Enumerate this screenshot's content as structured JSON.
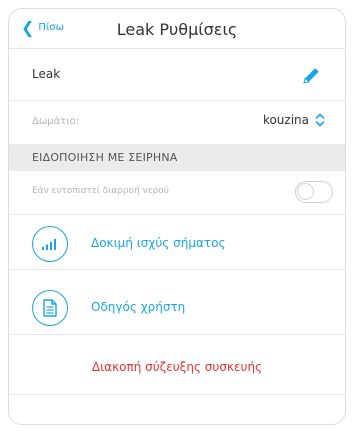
{
  "nav": {
    "back_label": "Πίσω",
    "title": "Leak Ρυθμίσεις"
  },
  "device": {
    "name": "Leak"
  },
  "room": {
    "label": "Δωμάτιο:",
    "value": "kouzina"
  },
  "section": {
    "title": "ΕΙΔΟΠΟΙΗΣΗ ΜΕ ΣΕΙΡΗΝΑ"
  },
  "leak_alert": {
    "label": "Εάν εντοπιστεί διαρροή νερού",
    "enabled": false
  },
  "actions": {
    "signal_test": "Δοκιμή ισχύς σήματος",
    "user_guide": "Οδηγός χρήστη",
    "unpair": "Διακοπή σύζευξης συσκευής"
  },
  "colors": {
    "accent": "#1aa6e6",
    "danger": "#e8322f",
    "section_bg": "#ebebeb"
  }
}
